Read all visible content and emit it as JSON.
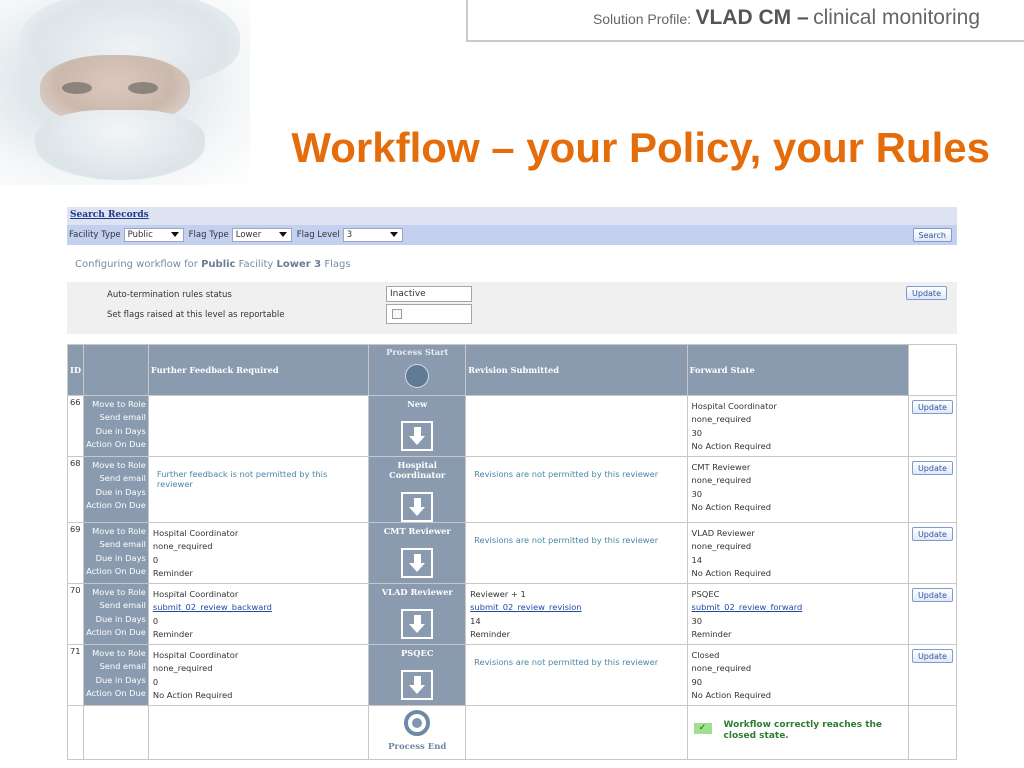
{
  "slide": {
    "profile_label": "Solution Profile:",
    "profile_product": "VLAD CM –",
    "profile_desc": "clinical monitoring",
    "title": "Workflow – your Policy, your Rules"
  },
  "app": {
    "search_records": "Search Records",
    "filters": {
      "facility_type_label": "Facility Type",
      "facility_type_value": "Public",
      "flag_type_label": "Flag Type",
      "flag_type_value": "Lower",
      "flag_level_label": "Flag Level",
      "flag_level_value": "3",
      "search_button": "Search"
    },
    "config": {
      "prefix": "Configuring workflow for",
      "facility": "Public",
      "mid": "Facility",
      "flags": "Lower 3",
      "suffix": "Flags"
    },
    "settings": {
      "auto_termination_label": "Auto-termination rules status",
      "auto_termination_value": "Inactive",
      "reportable_label": "Set flags raised at this level as reportable",
      "reportable_checked": false,
      "update_button": "Update"
    },
    "table": {
      "headers": {
        "id": "ID",
        "further": "Further Feedback Required",
        "process_start": "Process Start",
        "revision": "Revision Submitted",
        "forward": "Forward State"
      },
      "key_labels": [
        "Move to Role",
        "Send email",
        "Due in Days",
        "Action On Due"
      ],
      "update_label": "Update",
      "rows": [
        {
          "id": "66",
          "stage": "New",
          "further": [
            "",
            "",
            "",
            ""
          ],
          "further_note": "",
          "revision": [
            "",
            "",
            "",
            ""
          ],
          "revision_note": "",
          "forward": [
            "Hospital Coordinator",
            "none_required",
            "30",
            "No Action Required"
          ]
        },
        {
          "id": "68",
          "stage": "Hospital Coordinator",
          "further": [
            "",
            "",
            "",
            ""
          ],
          "further_note": "Further feedback is not permitted by this reviewer",
          "revision": [
            "",
            "",
            "",
            ""
          ],
          "revision_note": "Revisions are not permitted by this reviewer",
          "forward": [
            "CMT Reviewer",
            "none_required",
            "30",
            "No Action Required"
          ]
        },
        {
          "id": "69",
          "stage": "CMT Reviewer",
          "further": [
            "Hospital Coordinator",
            "none_required",
            "0",
            "Reminder"
          ],
          "further_note": "",
          "revision": [
            "",
            "",
            "",
            ""
          ],
          "revision_note": "Revisions are not permitted by this reviewer",
          "forward": [
            "VLAD Reviewer",
            "none_required",
            "14",
            "No Action Required"
          ]
        },
        {
          "id": "70",
          "stage": "VLAD Reviewer",
          "further": [
            "Hospital Coordinator",
            "submit_02_review_backward",
            "0",
            "Reminder"
          ],
          "further_note": "",
          "revision": [
            "Reviewer + 1",
            "submit_02_review_revision",
            "14",
            "Reminder"
          ],
          "revision_note": "",
          "forward": [
            "PSQEC",
            "submit_02_review_forward",
            "30",
            "Reminder"
          ]
        },
        {
          "id": "71",
          "stage": "PSQEC",
          "further": [
            "Hospital Coordinator",
            "none_required",
            "0",
            "No Action Required"
          ],
          "further_note": "",
          "revision": [
            "",
            "",
            "",
            ""
          ],
          "revision_note": "Revisions are not permitted by this reviewer",
          "forward": [
            "Closed",
            "none_required",
            "90",
            "No Action Required"
          ]
        }
      ],
      "process_end": "Process End",
      "success_message": "Workflow correctly reaches the closed state."
    }
  }
}
